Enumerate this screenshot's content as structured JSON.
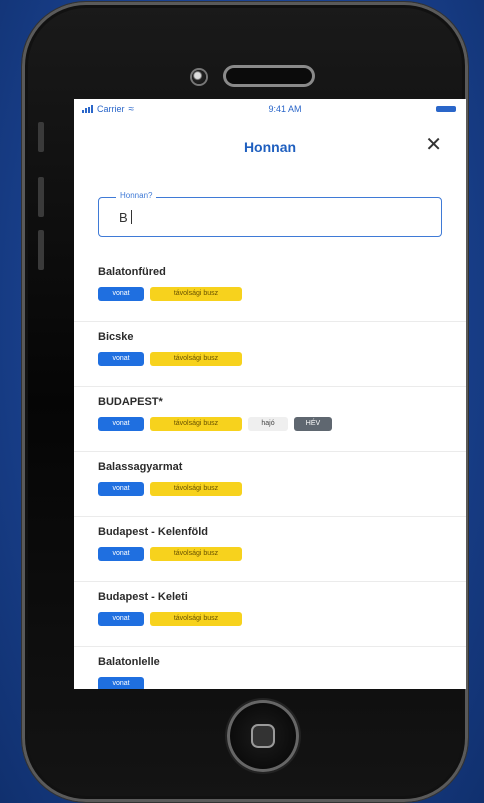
{
  "status_bar": {
    "carrier": "Carrier",
    "time": "9:41 AM"
  },
  "header": {
    "title": "Honnan",
    "close_icon": "close-icon"
  },
  "search": {
    "legend": "Honnan?",
    "value": "B"
  },
  "results": [
    {
      "name": "Balatonfüred",
      "tags": [
        "vonat",
        "távolsági busz"
      ]
    },
    {
      "name": "Bicske",
      "tags": [
        "vonat",
        "távolsági busz"
      ]
    },
    {
      "name": "BUDAPEST*",
      "tags": [
        "vonat",
        "távolsági busz",
        "hajó",
        "HÉV"
      ]
    },
    {
      "name": "Balassagyarmat",
      "tags": [
        "vonat",
        "távolsági busz"
      ]
    },
    {
      "name": "Budapest - Kelenföld",
      "tags": [
        "vonat",
        "távolsági busz"
      ]
    },
    {
      "name": "Budapest - Keleti",
      "tags": [
        "vonat",
        "távolsági busz"
      ]
    },
    {
      "name": "Balatonlelle",
      "tags": [
        "vonat"
      ]
    }
  ],
  "colors": {
    "accent": "#1f5fbf",
    "vonat": "#1f6fe0",
    "busz": "#f7d21d",
    "hev": "#5f6770",
    "background": "#1c4596"
  }
}
